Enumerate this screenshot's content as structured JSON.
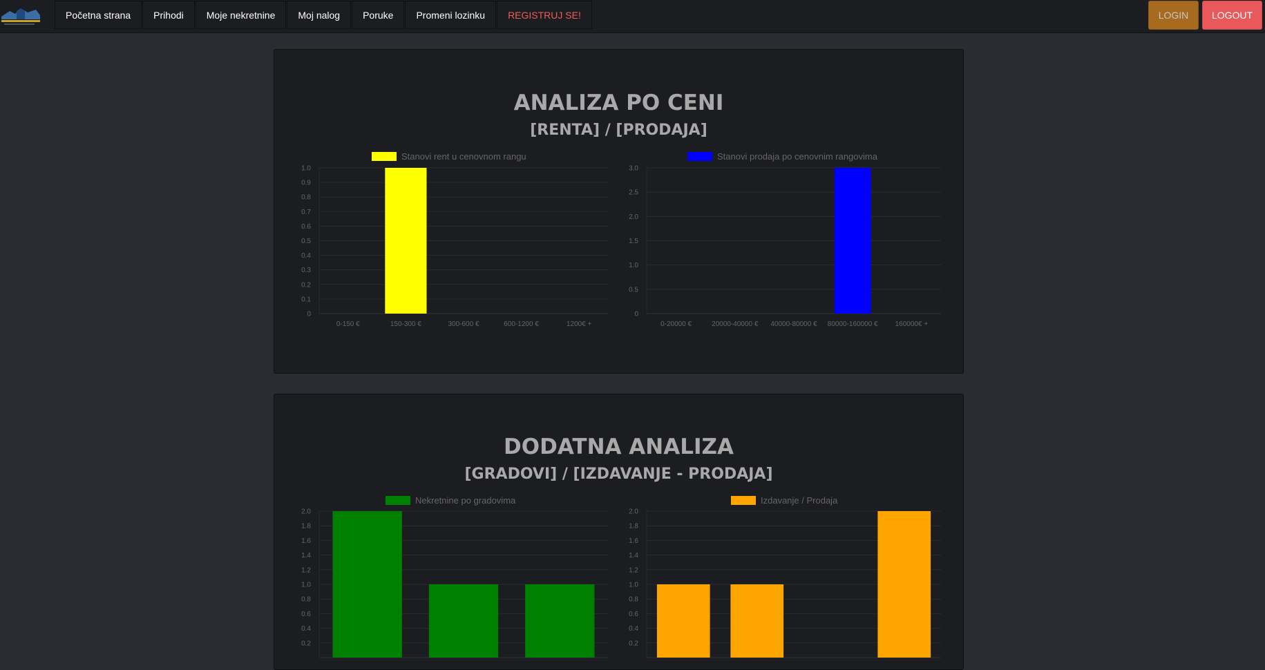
{
  "nav": {
    "items": [
      {
        "label": "Početna strana",
        "name": "nav-pocetna-strana"
      },
      {
        "label": "Prihodi",
        "name": "nav-prihodi"
      },
      {
        "label": "Moje nekretnine",
        "name": "nav-moje-nekretnine"
      },
      {
        "label": "Moj nalog",
        "name": "nav-moj-nalog"
      },
      {
        "label": "Poruke",
        "name": "nav-poruke"
      },
      {
        "label": "Promeni lozinku",
        "name": "nav-promeni-lozinku"
      },
      {
        "label": "REGISTRUJ SE!",
        "name": "nav-registruj-se"
      }
    ],
    "login_label": "LOGIN",
    "logout_label": "LOGOUT"
  },
  "section1": {
    "title": "ANALIZA PO CENI",
    "subtitle": "[RENTA] / [PRODAJA]"
  },
  "section2": {
    "title": "DODATNA ANALIZA",
    "subtitle": "[GRADOVI] / [IZDAVANJE - PRODAJA]"
  },
  "colors": {
    "yellow": "#ffff00",
    "blue": "#0000ff",
    "green": "#008000",
    "orange": "#ffa500"
  },
  "chart_data": [
    {
      "type": "bar",
      "legend": "Stanovi rent u cenovnom rangu",
      "color": "#ffff00",
      "categories": [
        "0-150 €",
        "150-300 €",
        "300-600 €",
        "600-1200 €",
        "1200€ +"
      ],
      "values": [
        0,
        1,
        0,
        0,
        0
      ],
      "ylim": [
        0,
        1.0
      ],
      "yticks": [
        "0",
        "0.1",
        "0.2",
        "0.3",
        "0.4",
        "0.5",
        "0.6",
        "0.7",
        "0.8",
        "0.9",
        "1.0"
      ],
      "ytick_values": [
        0,
        0.1,
        0.2,
        0.3,
        0.4,
        0.5,
        0.6,
        0.7,
        0.8,
        0.9,
        1.0
      ]
    },
    {
      "type": "bar",
      "legend": "Stanovi prodaja po cenovnim rangovima",
      "color": "#0000ff",
      "categories": [
        "0-20000 €",
        "20000-40000 €",
        "40000-80000 €",
        "80000-160000 €",
        "160000€ +"
      ],
      "values": [
        0,
        0,
        0,
        3,
        0
      ],
      "ylim": [
        0,
        3.0
      ],
      "yticks": [
        "0",
        "0.5",
        "1.0",
        "1.5",
        "2.0",
        "2.5",
        "3.0"
      ],
      "ytick_values": [
        0,
        0.5,
        1.0,
        1.5,
        2.0,
        2.5,
        3.0
      ]
    },
    {
      "type": "bar",
      "legend": "Nekretnine po gradovima",
      "color": "#008000",
      "categories": [
        "",
        "",
        ""
      ],
      "values": [
        2,
        1,
        1
      ],
      "ylim": [
        0,
        2.0
      ],
      "yticks": [
        "0.2",
        "0.4",
        "0.6",
        "0.8",
        "1.0",
        "1.2",
        "1.4",
        "1.6",
        "1.8",
        "2.0"
      ],
      "ytick_values": [
        0.2,
        0.4,
        0.6,
        0.8,
        1.0,
        1.2,
        1.4,
        1.6,
        1.8,
        2.0
      ]
    },
    {
      "type": "bar",
      "legend": "Izdavanje / Prodaja",
      "color": "#ffa500",
      "categories": [
        "",
        "",
        "",
        ""
      ],
      "values": [
        1,
        1,
        0,
        2
      ],
      "ylim": [
        0,
        2.0
      ],
      "yticks": [
        "0.2",
        "0.4",
        "0.6",
        "0.8",
        "1.0",
        "1.2",
        "1.4",
        "1.6",
        "1.8",
        "2.0"
      ],
      "ytick_values": [
        0.2,
        0.4,
        0.6,
        0.8,
        1.0,
        1.2,
        1.4,
        1.6,
        1.8,
        2.0
      ]
    }
  ]
}
